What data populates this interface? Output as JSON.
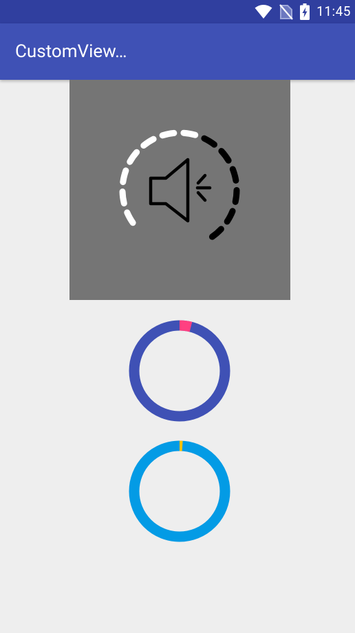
{
  "status_bar": {
    "time": "11:45",
    "icons": [
      "wifi-icon",
      "no-sim-icon",
      "battery-charging-icon"
    ],
    "background": "#303f9f"
  },
  "app_bar": {
    "title": "CustomView…",
    "background": "#3f51b5"
  },
  "volume_control": {
    "icon": "speaker-volume-icon",
    "background": "#757575",
    "level_fraction": 0.5,
    "active_color": "#ffffff",
    "inactive_color": "#000000"
  },
  "progress_rings": [
    {
      "name": "progress-ring-indigo",
      "track_color": "#3f51b5",
      "progress_color": "#ff4081",
      "progress_fraction": 0.04
    },
    {
      "name": "progress-ring-blue",
      "track_color": "#039be5",
      "progress_color": "#ffc107",
      "progress_fraction": 0.01
    }
  ]
}
